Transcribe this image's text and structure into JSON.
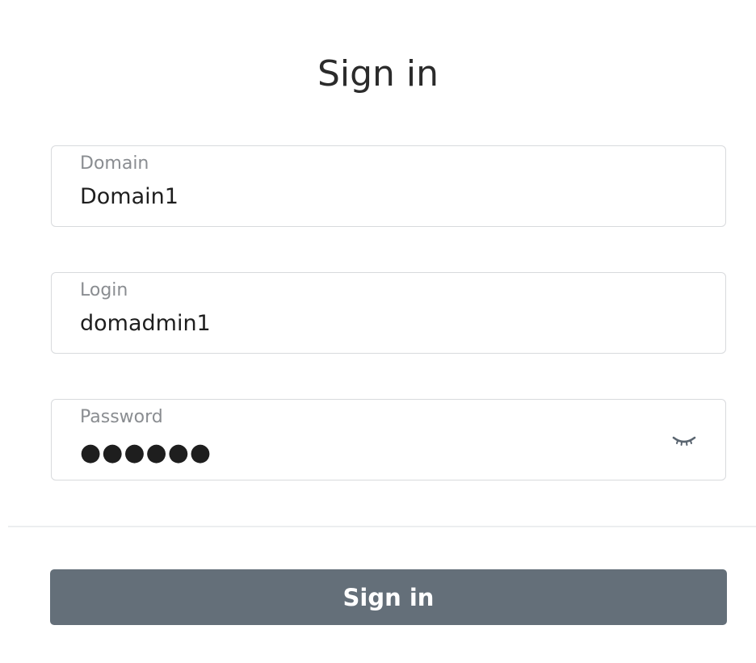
{
  "dialog": {
    "title": "Sign in"
  },
  "fields": {
    "domain": {
      "label": "Domain",
      "value": "Domain1"
    },
    "login": {
      "label": "Login",
      "value": "domadmin1"
    },
    "password": {
      "label": "Password",
      "value": "●●●●●●",
      "toggle_icon": "eye-closed-icon"
    }
  },
  "actions": {
    "submit_label": "Sign in",
    "submit_color": "#646f79"
  }
}
